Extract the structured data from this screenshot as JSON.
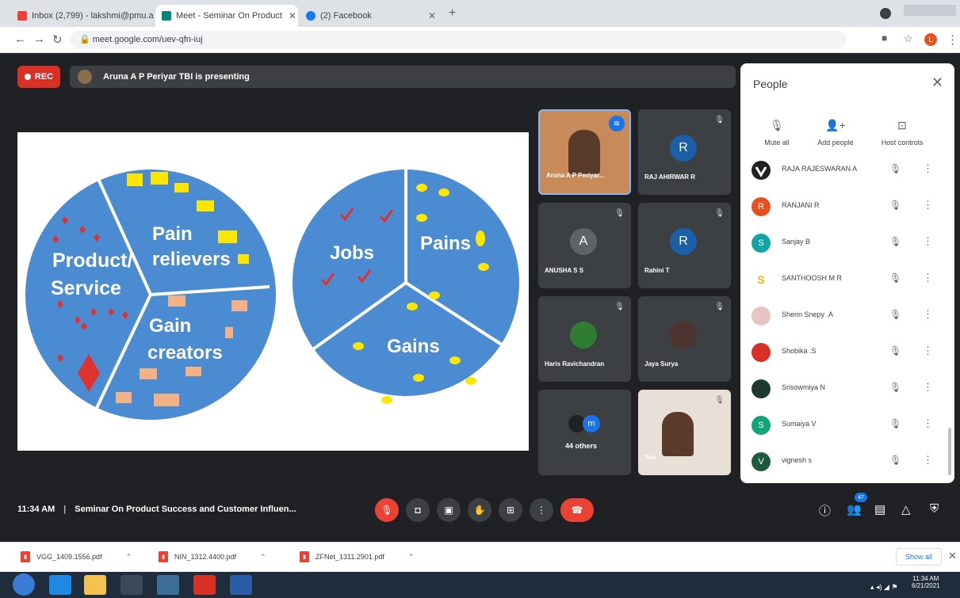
{
  "browser": {
    "tabs": [
      {
        "label": "Inbox (2,799) - lakshmi@pmu.ac",
        "icon": "gmail-icon"
      },
      {
        "label": "Meet - Seminar On Product",
        "icon": "meet-icon"
      },
      {
        "label": "(2) Facebook",
        "icon": "facebook-icon"
      }
    ],
    "url": "meet.google.com/uev-qfn-iuj",
    "profile_letter": "L"
  },
  "meet": {
    "rec_label": "REC",
    "presenting": "Aruna A P Periyar TBI is presenting",
    "slide": {
      "left_labels": [
        "Product/",
        "Service",
        "Pain",
        "relievers",
        "Gain",
        "creators"
      ],
      "right_labels": [
        "Jobs",
        "Pains",
        "Gains"
      ]
    },
    "tiles": [
      {
        "name": "Aruna A P Periyar...",
        "initial": ""
      },
      {
        "name": "RAJ AHIRWAR R",
        "initial": "R"
      },
      {
        "name": "ANUSHA S S",
        "initial": "A"
      },
      {
        "name": "Rahini T",
        "initial": "R"
      },
      {
        "name": "Haris Ravichandran",
        "initial": ""
      },
      {
        "name": "Jaya Surya",
        "initial": ""
      },
      {
        "name": "44 others",
        "initial": "m"
      },
      {
        "name": "You",
        "initial": ""
      }
    ],
    "time": "11:34 AM",
    "meeting_title": "Seminar On Product Success and Customer Influen...",
    "participant_badge": "47"
  },
  "people": {
    "title": "People",
    "actions": [
      "Mute all",
      "Add people",
      "Host controls"
    ],
    "rows": [
      {
        "name": "RAJA RAJESWARAN A",
        "initial": "",
        "color": "#202124"
      },
      {
        "name": "RANJANI R",
        "initial": "R",
        "color": "#e8501f"
      },
      {
        "name": "Sanjay B",
        "initial": "S",
        "color": "#12a4a4"
      },
      {
        "name": "SANTHOOSH M R",
        "initial": "S",
        "color": "#f4b400"
      },
      {
        "name": "Sherin Snepy .A",
        "initial": "",
        "color": "#e8c4c4"
      },
      {
        "name": "Shobika .S",
        "initial": "",
        "color": "#d93025"
      },
      {
        "name": "Srisowmiya N",
        "initial": "",
        "color": "#1e3a2e"
      },
      {
        "name": "Sumaiya V",
        "initial": "S",
        "color": "#12a47a"
      },
      {
        "name": "vignesh s",
        "initial": "V",
        "color": "#1e5a3e"
      }
    ]
  },
  "downloads": [
    {
      "name": "VGG_1409.1556.pdf"
    },
    {
      "name": "NIN_1312.4400.pdf"
    },
    {
      "name": "ZFNet_1311.2901.pdf"
    }
  ],
  "downloads_show_all": "Show all",
  "taskbar": {
    "time": "11:34 AM",
    "date": "6/21/2021"
  }
}
